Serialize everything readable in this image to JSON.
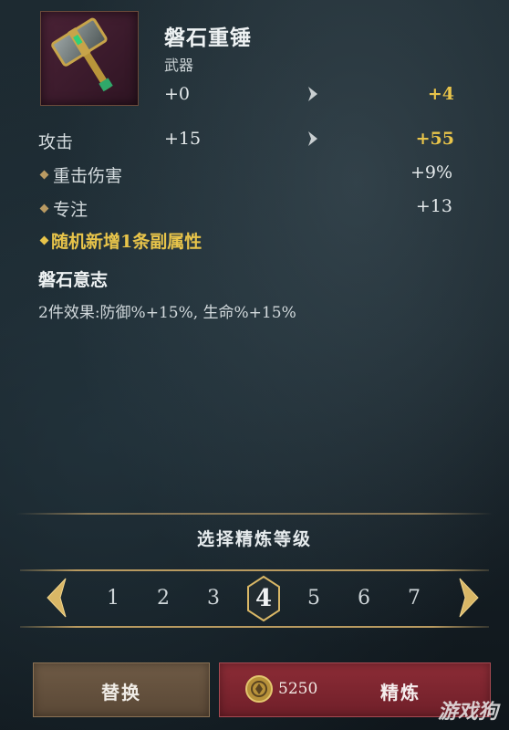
{
  "item": {
    "name": "磐石重锤",
    "type": "武器",
    "level_old": "+0",
    "level_new": "+4",
    "icon": "stone-hammer-icon"
  },
  "stats": {
    "attack": {
      "label": "攻击",
      "old": "+15",
      "new": "+55"
    },
    "sub": [
      {
        "label": "重击伤害",
        "value": "+9%"
      },
      {
        "label": "专注",
        "value": "+13"
      }
    ],
    "random_line": "随机新增1条副属性"
  },
  "set_bonus": {
    "title": "磐石意志",
    "effect": "2件效果:防御%+15%, 生命%+15%"
  },
  "refine": {
    "title": "选择精炼等级",
    "levels": [
      "1",
      "2",
      "3",
      "4",
      "5",
      "6",
      "7"
    ],
    "selected": "4"
  },
  "buttons": {
    "replace_label": "替换",
    "refine_label": "精炼",
    "cost": "5250"
  },
  "watermark": "游戏狗",
  "colors": {
    "highlight": "#e8c44a",
    "refine_button": "#8c2c36",
    "replace_button": "#6e5a45",
    "item_frame": "#4a2236"
  }
}
